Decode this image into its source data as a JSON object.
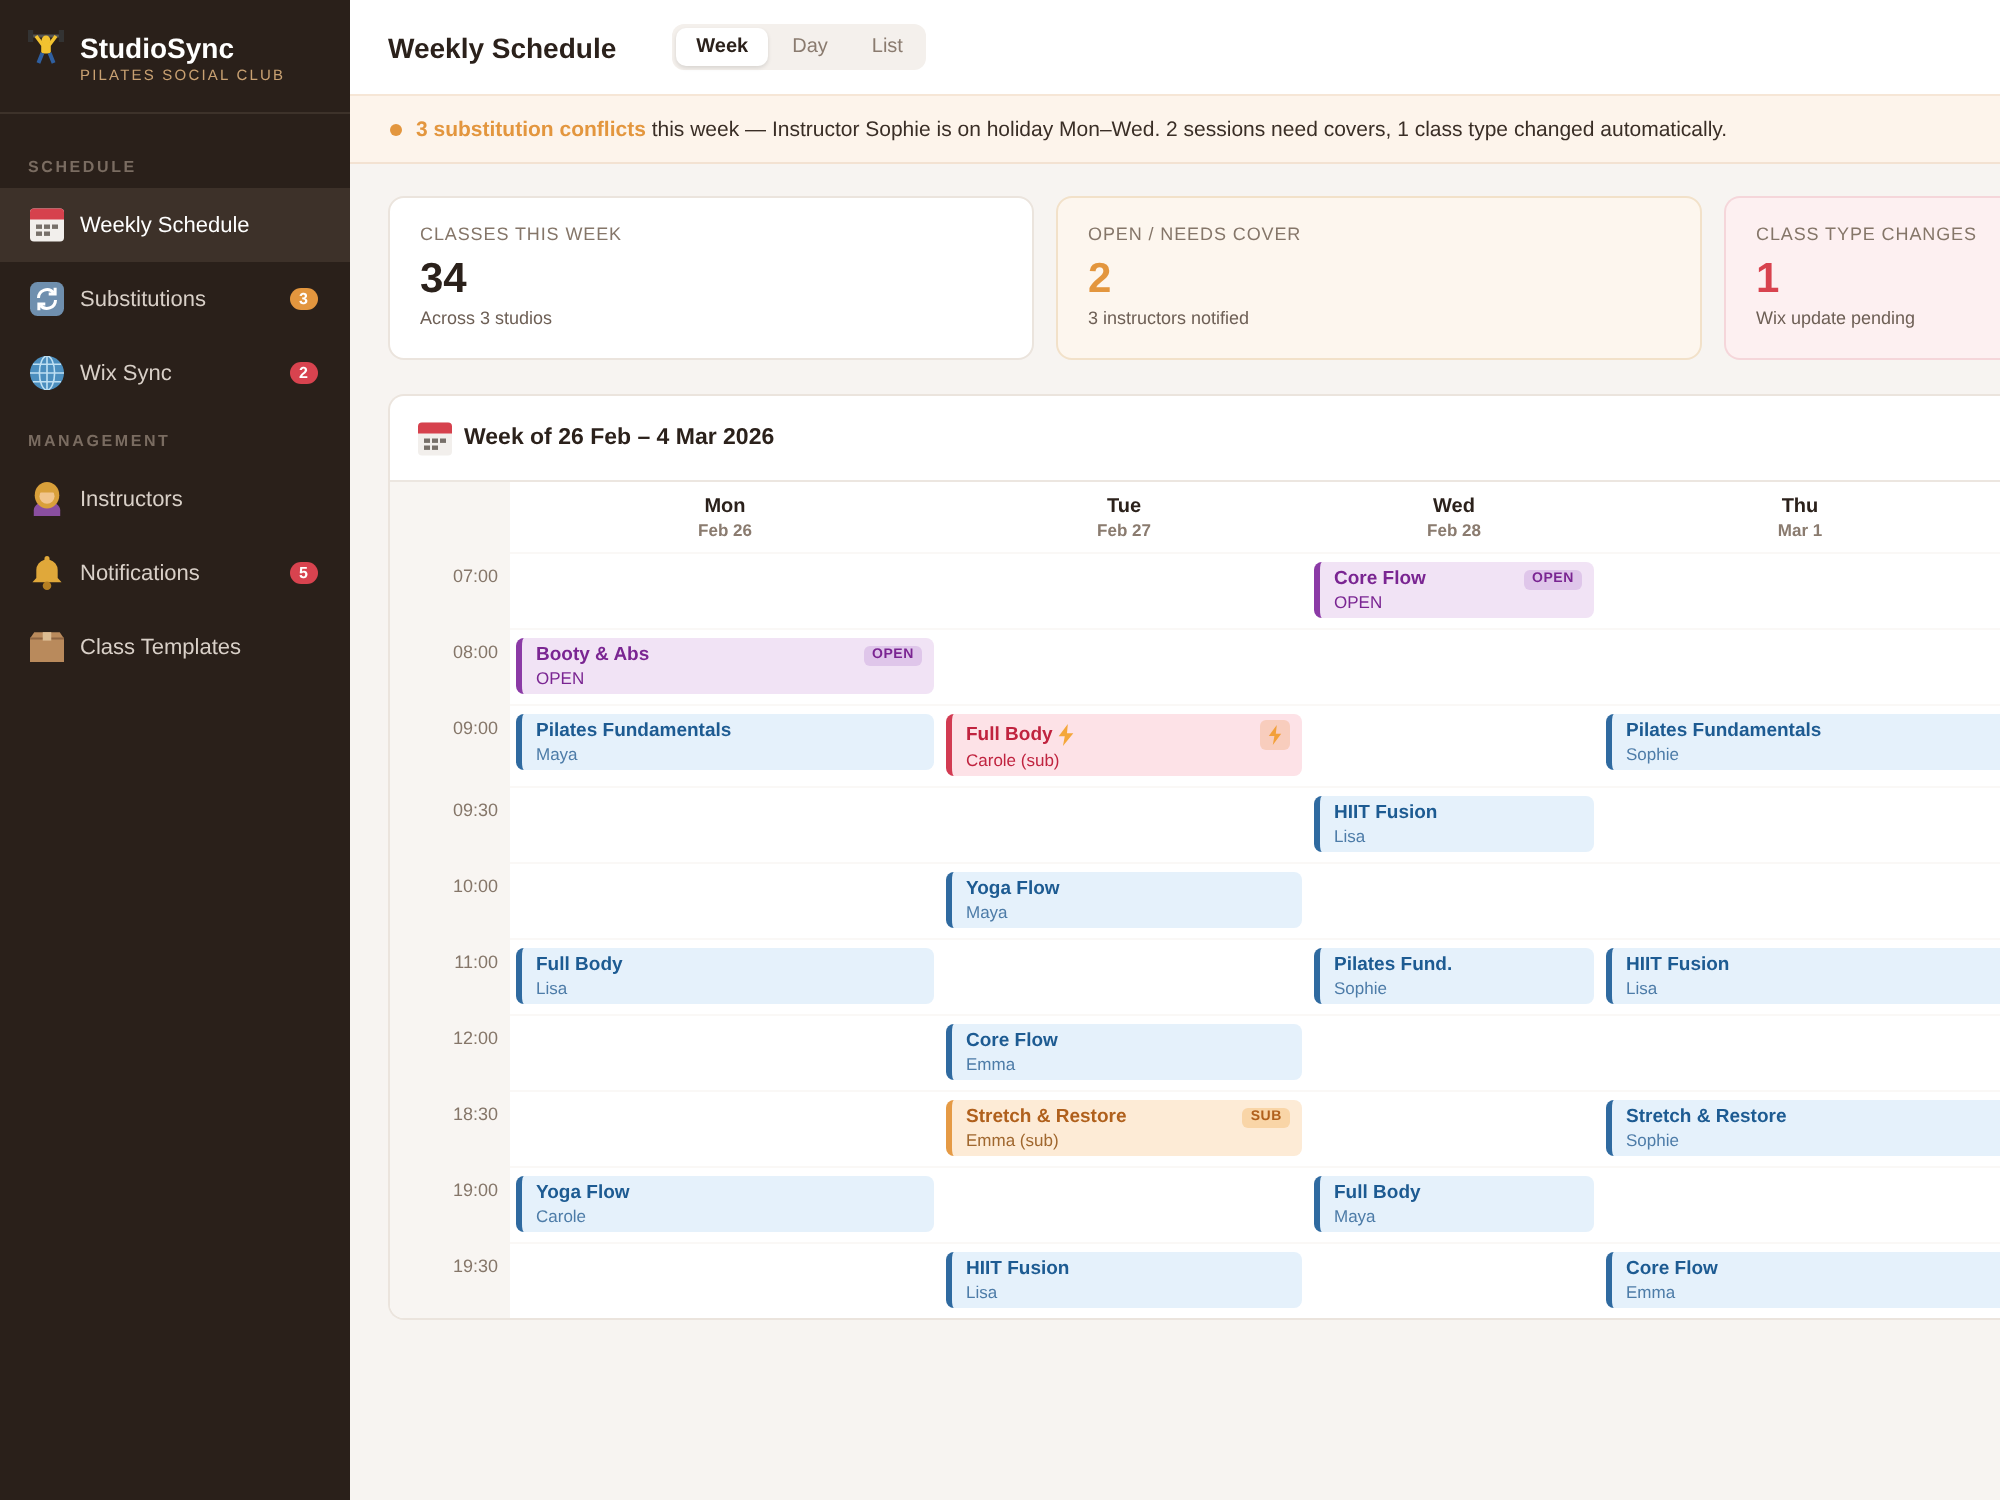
{
  "sidebar": {
    "brand": {
      "name": "StudioSync",
      "tagline": "PILATES SOCIAL CLUB"
    },
    "sections": [
      {
        "label": "SCHEDULE",
        "items": [
          {
            "label": "Weekly Schedule",
            "selected": true
          },
          {
            "label": "Substitutions",
            "selected": false,
            "badge": {
              "text": "3",
              "color": "#e3963e"
            }
          },
          {
            "label": "Wix Sync",
            "selected": false,
            "badge": {
              "text": "2",
              "color": "#d8434f"
            }
          }
        ]
      },
      {
        "label": "MANAGEMENT",
        "items": [
          {
            "label": "Instructors",
            "selected": false
          },
          {
            "label": "Notifications",
            "selected": false,
            "badge": {
              "text": "5",
              "color": "#d8434f"
            }
          },
          {
            "label": "Class Templates",
            "selected": false
          }
        ]
      }
    ]
  },
  "header": {
    "title": "Weekly Schedule",
    "views": [
      {
        "label": "Week",
        "selected": true
      },
      {
        "label": "Day",
        "selected": false
      },
      {
        "label": "List",
        "selected": false
      }
    ]
  },
  "alert": {
    "text": "**3 substitution conflicts** this week — Instructor Sophie is on holiday Mon–Wed. 2 sessions need covers, 1 class type changed automatically."
  },
  "stats": [
    {
      "kind": "neutral",
      "label": "CLASSES THIS WEEK",
      "value": "34",
      "note": "Across 3 studios"
    },
    {
      "kind": "warning",
      "label": "OPEN / NEEDS COVER",
      "value": "2",
      "note": "3 instructors notified"
    },
    {
      "kind": "danger",
      "label": "CLASS TYPE CHANGES",
      "value": "1",
      "note": "Wix update pending"
    }
  ],
  "calendar": {
    "title": "Week of 26 Feb – 4 Mar 2026",
    "days": [
      {
        "name": "Mon",
        "date": "Feb 26"
      },
      {
        "name": "Tue",
        "date": "Feb 27"
      },
      {
        "name": "Wed",
        "date": "Feb 28"
      },
      {
        "name": "Thu",
        "date": "Mar 1"
      }
    ],
    "rows": [
      {
        "time": "07:00",
        "wed": {
          "kind": "open",
          "title": "Core Flow",
          "subtitle": "OPEN",
          "badge": "OPEN"
        }
      },
      {
        "time": "08:00",
        "mon": {
          "kind": "open",
          "title": "Booty & Abs",
          "subtitle": "OPEN",
          "badge": "OPEN"
        }
      },
      {
        "time": "09:00",
        "mon": {
          "kind": "class",
          "title": "Pilates Fundamentals",
          "subtitle": "Maya"
        },
        "tue": {
          "kind": "changed",
          "title": "Full Body",
          "subtitle": "Carole (sub)"
        },
        "thu": {
          "kind": "class",
          "title": "Pilates Fundamentals",
          "subtitle": "Sophie"
        }
      },
      {
        "time": "09:30",
        "wed": {
          "kind": "class",
          "title": "HIIT Fusion",
          "subtitle": "Lisa"
        }
      },
      {
        "time": "10:00",
        "tue": {
          "kind": "class",
          "title": "Yoga Flow",
          "subtitle": "Maya"
        }
      },
      {
        "time": "11:00",
        "mon": {
          "kind": "class",
          "title": "Full Body",
          "subtitle": "Lisa"
        },
        "wed": {
          "kind": "class",
          "title": "Pilates Fund.",
          "subtitle": "Sophie"
        },
        "thu": {
          "kind": "class",
          "title": "HIIT Fusion",
          "subtitle": "Lisa"
        }
      },
      {
        "time": "12:00",
        "tue": {
          "kind": "class",
          "title": "Core Flow",
          "subtitle": "Emma"
        }
      },
      {
        "time": "18:30",
        "tue": {
          "kind": "sub",
          "title": "Stretch & Restore",
          "subtitle": "Emma (sub)",
          "badge": "SUB"
        },
        "thu": {
          "kind": "class",
          "title": "Stretch & Restore",
          "subtitle": "Sophie"
        }
      },
      {
        "time": "19:00",
        "mon": {
          "kind": "class",
          "title": "Yoga Flow",
          "subtitle": "Carole"
        },
        "wed": {
          "kind": "class",
          "title": "Full Body",
          "subtitle": "Maya"
        }
      },
      {
        "time": "19:30",
        "tue": {
          "kind": "class",
          "title": "HIIT Fusion",
          "subtitle": "Lisa"
        },
        "thu": {
          "kind": "class",
          "title": "Core Flow",
          "subtitle": "Emma"
        }
      }
    ]
  }
}
